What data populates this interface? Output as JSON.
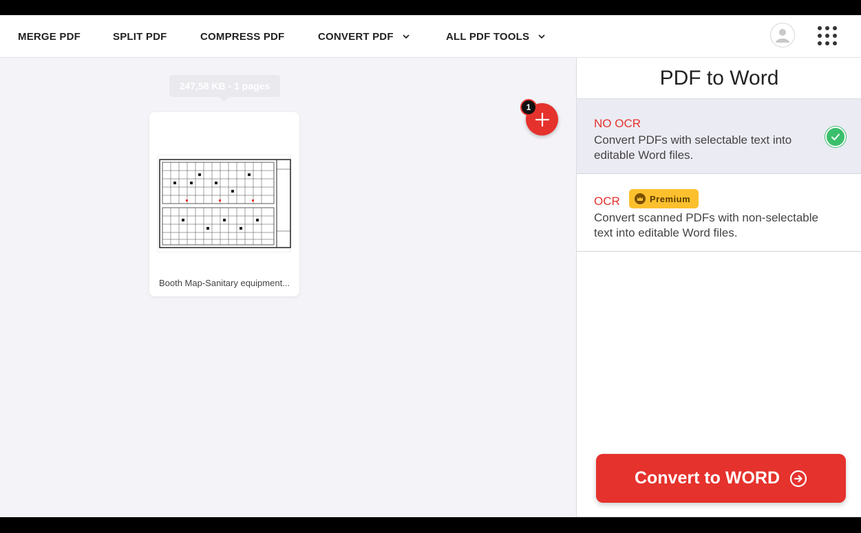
{
  "nav": {
    "items": [
      {
        "label": "MERGE PDF"
      },
      {
        "label": "SPLIT PDF"
      },
      {
        "label": "COMPRESS PDF"
      },
      {
        "label": "CONVERT PDF"
      },
      {
        "label": "ALL PDF TOOLS"
      }
    ],
    "avatar_icon": "user-icon",
    "apps_icon": "grid-menu-icon"
  },
  "workspace": {
    "tooltip": "247,58 KB - 1 pages",
    "file": {
      "name": "Booth Map-Sanitary equipment...",
      "thumbnail_icon": "floorplan-thumbnail"
    },
    "file_count": "1",
    "add_icon": "plus-icon"
  },
  "sidebar": {
    "title": "PDF to Word",
    "options": [
      {
        "title": "NO OCR",
        "description": "Convert PDFs with selectable text into editable Word files.",
        "selected": true
      },
      {
        "title": "OCR",
        "description": "Convert scanned PDFs with non-selectable text into editable Word files.",
        "badge": "Premium",
        "selected": false
      }
    ],
    "convert_label": "Convert to WORD"
  },
  "colors": {
    "accent": "#e5322d",
    "success": "#3bbf6c",
    "premium": "#fcc02e",
    "selected_bg": "#ebebf3"
  }
}
